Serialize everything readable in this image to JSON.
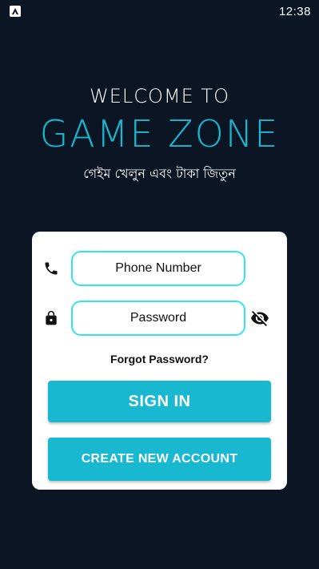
{
  "status_bar": {
    "time": "12:38",
    "app_icon": "a-icon"
  },
  "header": {
    "welcome": "WELCOME TO",
    "title": "GAME ZONE",
    "tagline": "গেইম খেলুন এবং টাকা জিতুন"
  },
  "login_form": {
    "phone_placeholder": "Phone Number",
    "phone_icon": "phone-icon",
    "password_placeholder": "Password",
    "password_icon": "lock-icon",
    "visibility_icon": "eye-off-icon",
    "forgot_password": "Forgot Password?",
    "sign_in_label": "SIGN IN",
    "create_account_label": "CREATE NEW ACCOUNT"
  },
  "colors": {
    "background": "#0b1524",
    "accent": "#17b8d0",
    "input_border": "#35e3f0",
    "card": "#ffffff"
  }
}
